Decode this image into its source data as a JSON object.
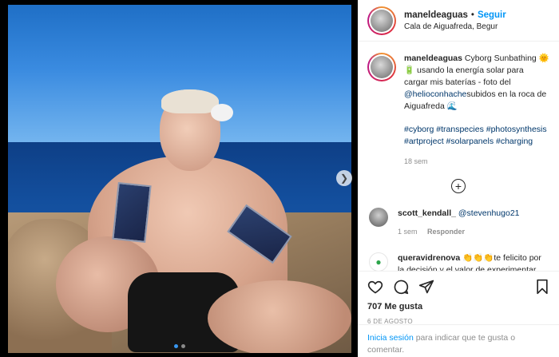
{
  "post": {
    "username": "maneldeaguas",
    "separator": "•",
    "follow_label": "Seguir",
    "location": "Cala de Aiguafreda, Begur"
  },
  "caption": {
    "username": "maneldeaguas",
    "text_part1": "Cyborg Sunbathing 🌞 🔋 usando la energía solar para cargar mis baterías - foto del ",
    "mention": "@helioconhache",
    "text_part2": "subidos en la roca de Aiguafreda 🌊",
    "hashtags": [
      "#cyborg",
      "#transpecies",
      "#photosynthesis",
      "#artproject",
      "#solarpanels",
      "#charging"
    ],
    "time": "18 sem"
  },
  "comments": [
    {
      "username": "scott_kendall_",
      "mention": "@stevenhugo21",
      "text": "",
      "time": "1 sem",
      "reply_label": "Responder"
    },
    {
      "username": "queravidrenova",
      "mention": "",
      "text": "👏👏👏te felicito por la decisión y el valor de experimentar",
      "time": "",
      "reply_label": ""
    }
  ],
  "icons": {
    "like": "heart-icon",
    "comment": "comment-icon",
    "share": "share-icon",
    "save": "bookmark-icon",
    "add_comments": "plus-circle-icon",
    "next": "chevron-right-icon"
  },
  "likes": "707 Me gusta",
  "date": "6 DE AGOSTO",
  "login_prompt": {
    "link": "Inicia sesión",
    "text": " para indicar que te gusta o comentar."
  },
  "carousel": {
    "current": 1,
    "total": 2
  },
  "colors": {
    "accent": "#0095f6",
    "muted": "#8e8e8e",
    "text": "#262626"
  }
}
